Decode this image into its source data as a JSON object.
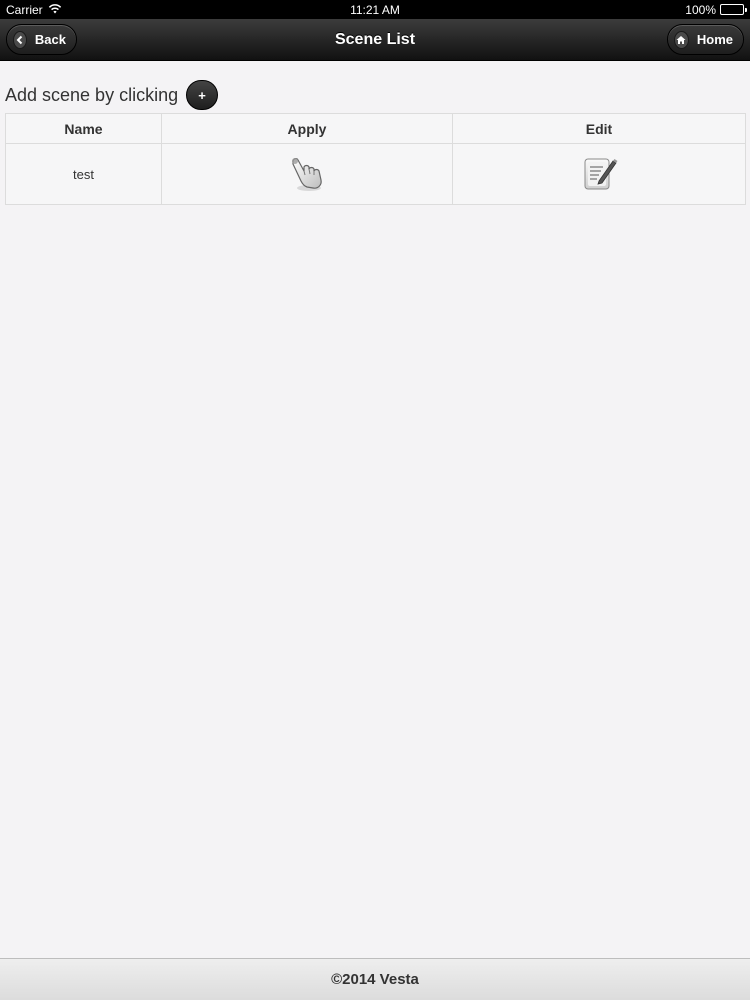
{
  "status_bar": {
    "carrier": "Carrier",
    "time": "11:21 AM",
    "battery_text": "100%",
    "battery_level": 1.0
  },
  "header": {
    "title": "Scene List",
    "back_label": "Back",
    "home_label": "Home"
  },
  "add_scene": {
    "label": "Add scene by clicking",
    "button_label": "+"
  },
  "table": {
    "columns": [
      "Name",
      "Apply",
      "Edit"
    ],
    "rows": [
      {
        "name": "test",
        "apply_icon": "pointing-hand-icon",
        "edit_icon": "edit-note-icon"
      }
    ]
  },
  "footer": {
    "text": "©2014 Vesta"
  },
  "colors": {
    "navbar": "#1e1e1e",
    "background": "#f4f3f5",
    "footer": "#e5e5e5"
  }
}
